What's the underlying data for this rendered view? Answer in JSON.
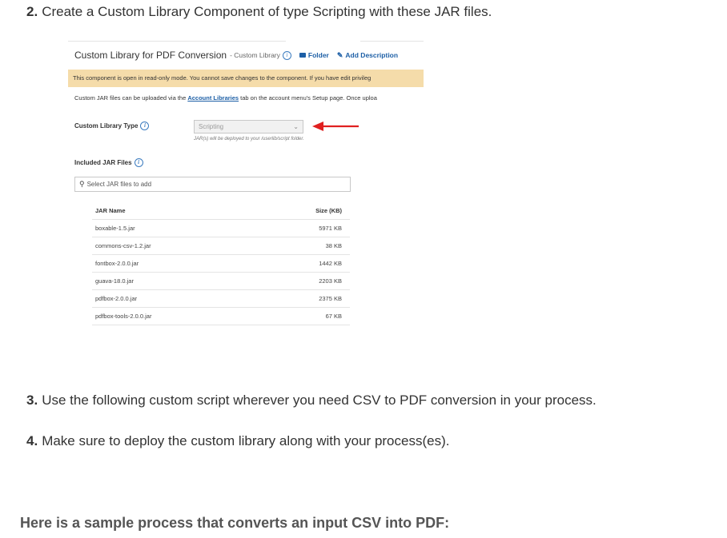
{
  "steps": [
    {
      "num": "2.",
      "text": "Create a Custom Library Component of type Scripting with these JAR files."
    },
    {
      "num": "3.",
      "text": "Use the following custom script wherever you need CSV to PDF conversion in your process."
    },
    {
      "num": "4.",
      "text": "Make sure to deploy the custom library along with your process(es)."
    }
  ],
  "sample_heading": "Here is a sample process that converts an input CSV into PDF:",
  "component": {
    "title": "Custom Library for PDF Conversion",
    "subtitle": "- Custom Library",
    "folder_link": "Folder",
    "description_link": "Add Description",
    "readonly_banner": "This component is open in read-only mode. You cannot save changes to the component. If you have edit privileg",
    "upload_prefix": "Custom JAR files can be uploaded via the ",
    "upload_link": "Account Libraries",
    "upload_suffix": " tab on the account menu's Setup page. Once uploa",
    "type_label": "Custom Library Type",
    "type_value": "Scripting",
    "type_hint": "JAR(s) will be deployed to your /userlib/script folder.",
    "included_label": "Included JAR Files",
    "search_placeholder": "Select JAR files to add",
    "table": {
      "headers": {
        "name": "JAR Name",
        "size": "Size (KB)"
      },
      "rows": [
        {
          "name": "boxable-1.5.jar",
          "size": "5971 KB"
        },
        {
          "name": "commons-csv-1.2.jar",
          "size": "38 KB"
        },
        {
          "name": "fontbox-2.0.0.jar",
          "size": "1442 KB"
        },
        {
          "name": "guava-18.0.jar",
          "size": "2203 KB"
        },
        {
          "name": "pdfbox-2.0.0.jar",
          "size": "2375 KB"
        },
        {
          "name": "pdfbox-tools-2.0.0.jar",
          "size": "67 KB"
        }
      ]
    }
  },
  "colors": {
    "arrow": "#e02020",
    "banner": "#f5dcaa",
    "link": "#1d5fa6"
  }
}
